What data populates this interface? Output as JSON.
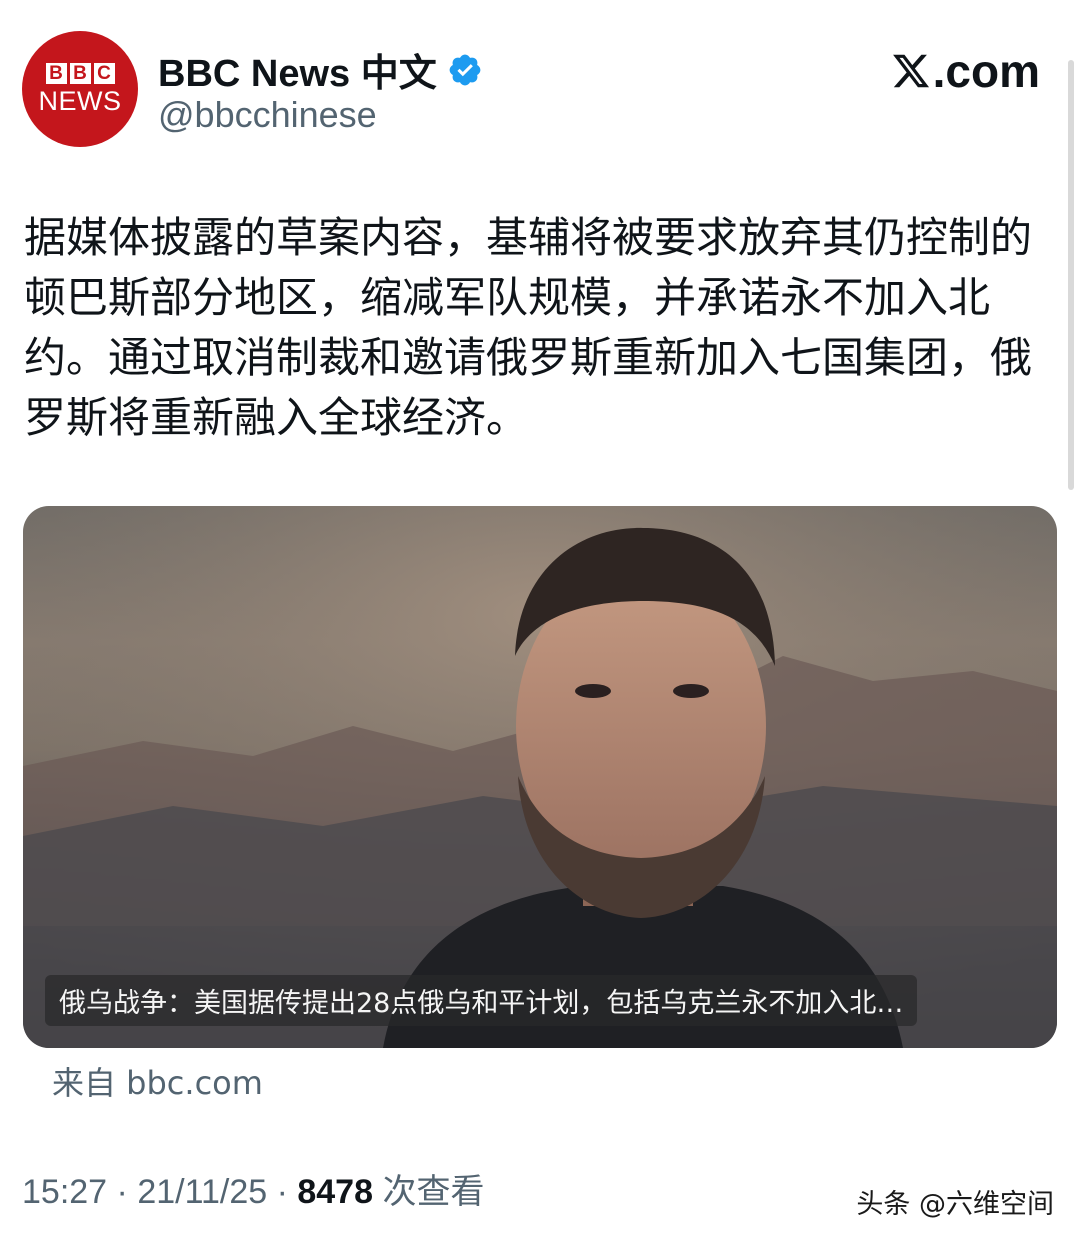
{
  "account": {
    "logo_bbc": [
      "B",
      "B",
      "C"
    ],
    "logo_news": "NEWS",
    "display_name": "BBC News 中文",
    "handle": "@bbcchinese",
    "verified": true
  },
  "site_brand": ".com",
  "post_text": "据媒体披露的草案内容，基辅将被要求放弃其仍控制的顿巴斯部分地区，缩减军队规模，并承诺永不加入北约。通过取消制裁和邀请俄罗斯重新加入七国集团，俄罗斯将重新融入全球经济。",
  "link_card": {
    "caption": "俄乌战争：美国据传提出28点俄乌和平计划，包括乌克兰永不加入北…",
    "source": "来自 bbc.com"
  },
  "meta": {
    "time": "15:27",
    "date": "21/11/25",
    "views_count": "8478",
    "views_label": "次查看",
    "separator": " · "
  },
  "watermark": "头条 @六维空间",
  "colors": {
    "bbc_red": "#c4161c",
    "verified_blue": "#1d9bf0",
    "text_primary": "#0f1419",
    "text_secondary": "#536471"
  }
}
